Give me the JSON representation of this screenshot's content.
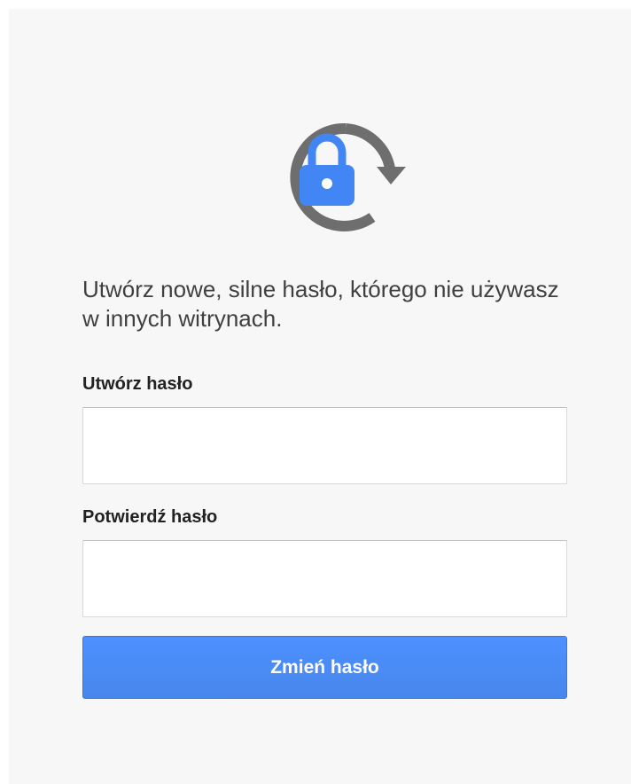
{
  "header": {
    "icon": "lock-refresh-icon",
    "colors": {
      "lock": "#4285f4",
      "arrow": "#6e6e6e"
    }
  },
  "form": {
    "description": "Utwórz nowe, silne hasło, którego nie używasz w innych witrynach.",
    "create_label": "Utwórz hasło",
    "create_value": "",
    "confirm_label": "Potwierdź hasło",
    "confirm_value": "",
    "submit_label": "Zmień hasło"
  },
  "colors": {
    "button": "#4d90fe",
    "background": "#f7f7f7"
  }
}
